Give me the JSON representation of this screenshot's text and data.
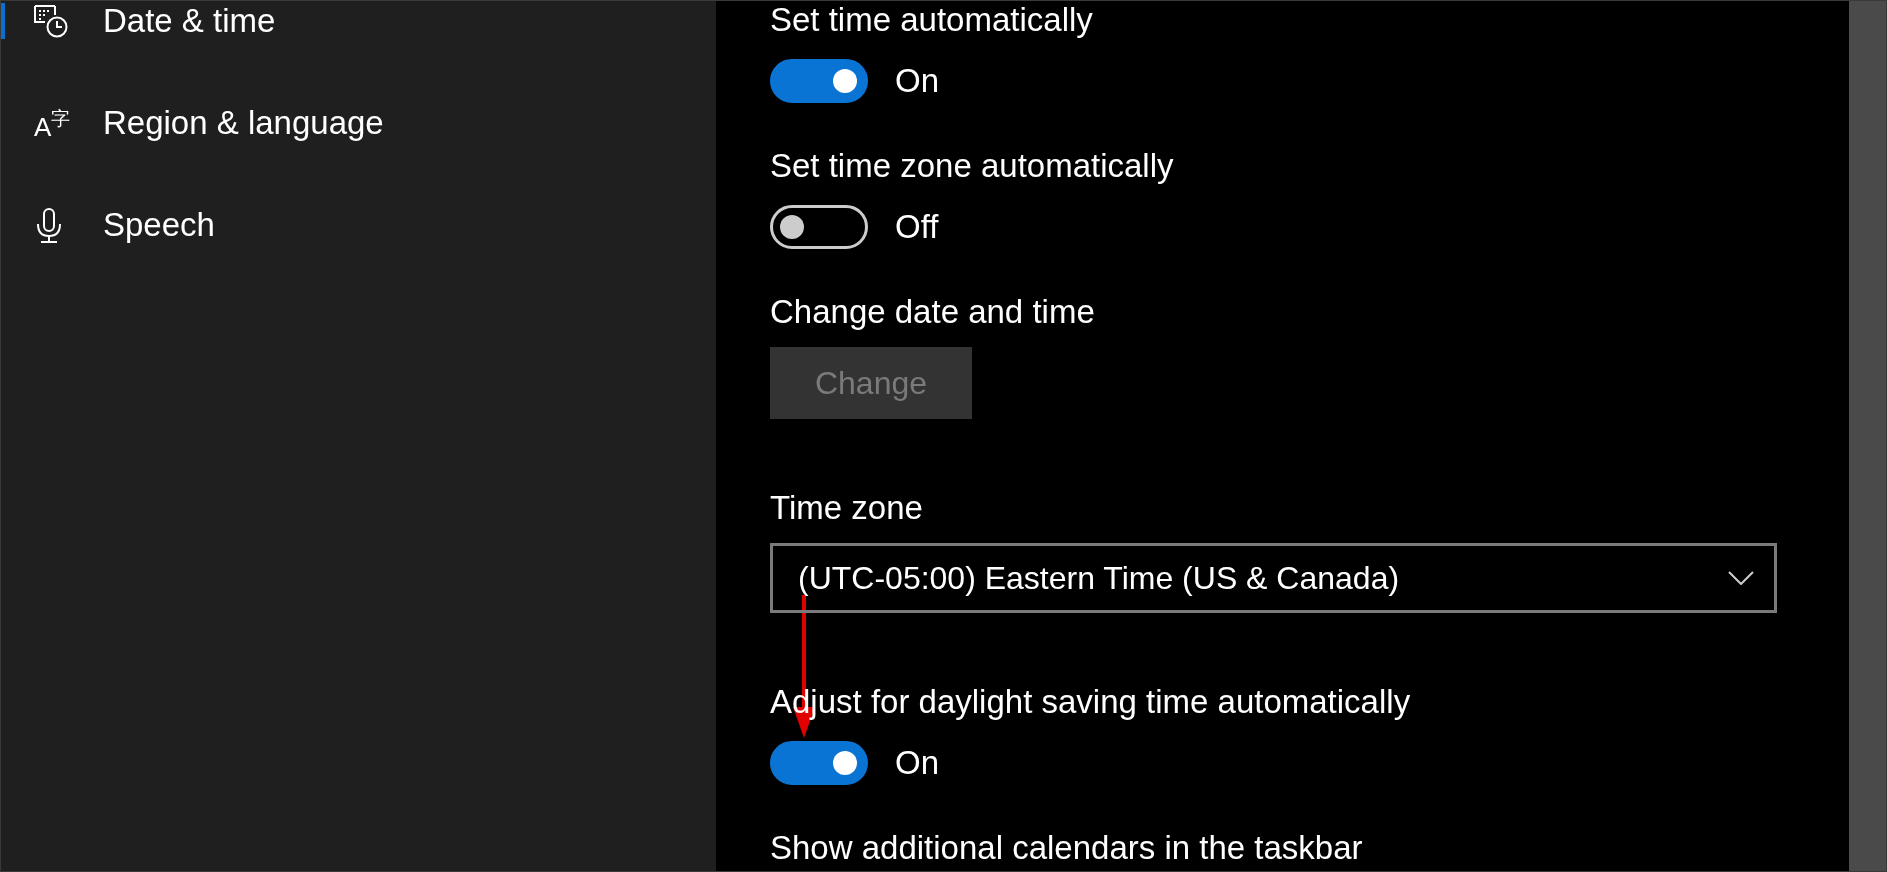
{
  "sidebar": {
    "items": [
      {
        "label": "Date & time",
        "selected": true
      },
      {
        "label": "Region & language",
        "selected": false,
        "icon_glyph": "A$^{字}$"
      },
      {
        "label": "Speech",
        "selected": false
      }
    ]
  },
  "settings": [
    {
      "kind": "toggle",
      "label": "Set time automatically",
      "on": true,
      "state_text": "On"
    },
    {
      "kind": "toggle",
      "label": "Set time zone automatically",
      "on": false,
      "state_text": "Off"
    },
    {
      "kind": "button",
      "label": "Change date and time",
      "button": "Change",
      "disabled": true
    },
    {
      "kind": "dropdown",
      "label": "Time zone",
      "value": "(UTC-05:00) Eastern Time (US & Canada)"
    },
    {
      "kind": "toggle",
      "label": "Adjust for daylight saving time automatically",
      "on": true,
      "state_text": "On"
    },
    {
      "kind": "heading",
      "label": "Show additional calendars in the taskbar"
    }
  ]
}
